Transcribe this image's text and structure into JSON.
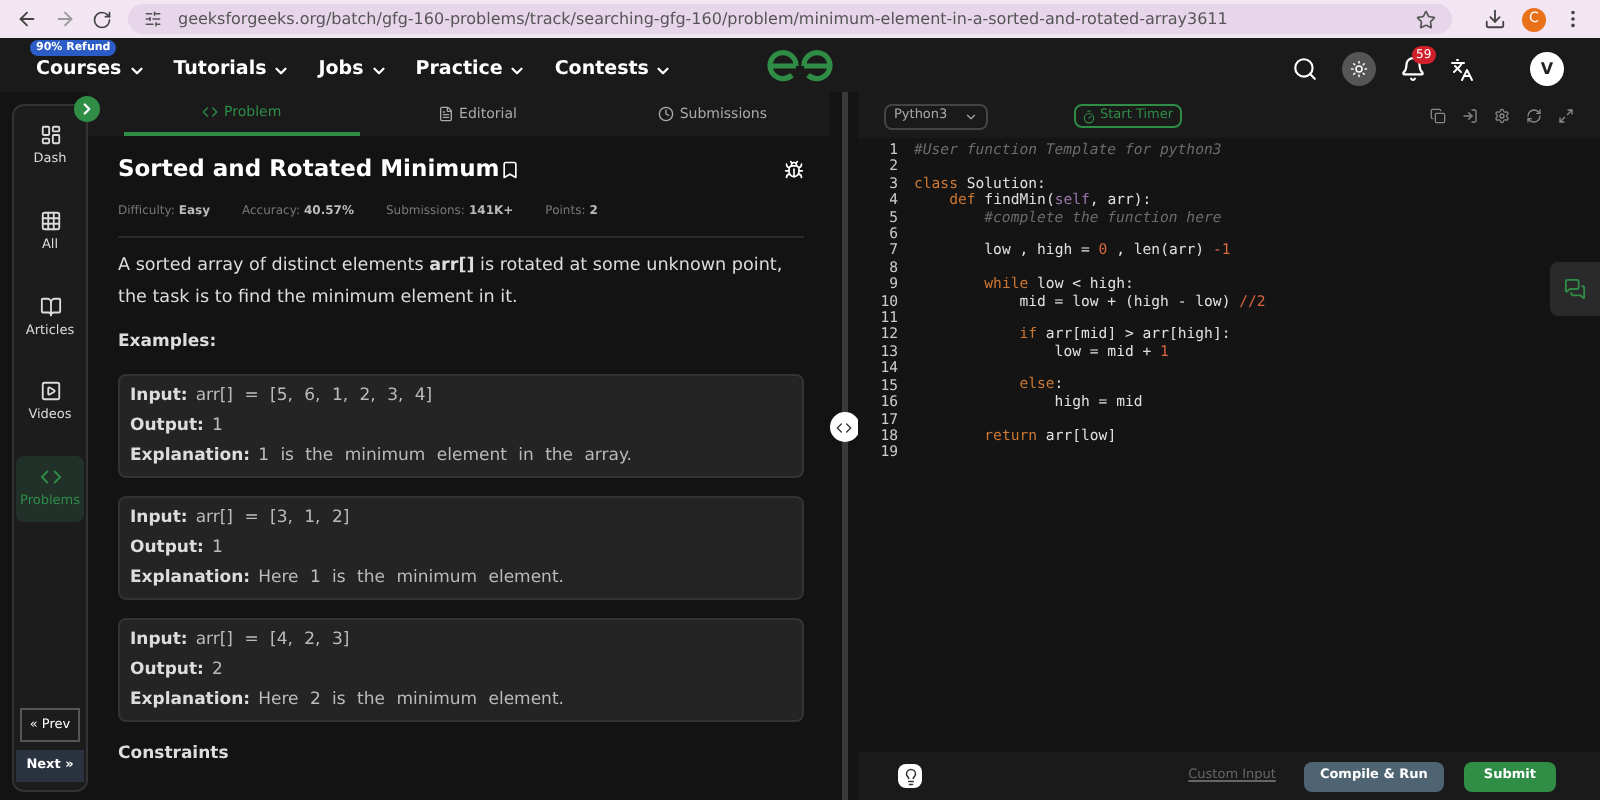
{
  "browser": {
    "url": "geeksforgeeks.org/batch/gfg-160-problems/track/searching-gfg-160/problem/minimum-element-in-a-sorted-and-rotated-array3611",
    "profile": "C"
  },
  "nav": {
    "badge": "90% Refund",
    "items": [
      "Courses",
      "Tutorials",
      "Jobs",
      "Practice",
      "Contests"
    ],
    "notifications": "59",
    "avatar": "V"
  },
  "sidebar": {
    "items": [
      {
        "label": "Dash",
        "selected": false
      },
      {
        "label": "All",
        "selected": false
      },
      {
        "label": "Articles",
        "selected": false
      },
      {
        "label": "Videos",
        "selected": false
      },
      {
        "label": "Problems",
        "selected": true
      }
    ],
    "prev": "« Prev",
    "next": "Next »"
  },
  "tabs": [
    {
      "label": "Problem",
      "selected": true
    },
    {
      "label": "Editorial",
      "selected": false
    },
    {
      "label": "Submissions",
      "selected": false
    }
  ],
  "problem": {
    "title": "Sorted and Rotated Minimum",
    "stats": [
      {
        "label": "Difficulty:",
        "value": "Easy"
      },
      {
        "label": "Accuracy:",
        "value": "40.57%"
      },
      {
        "label": "Submissions:",
        "value": "141K+"
      },
      {
        "label": "Points:",
        "value": "2"
      }
    ],
    "description": "A sorted array of distinct elements **arr[]** is rotated at some unknown point, the task is to find the minimum element in it.",
    "examples_heading": "Examples:",
    "examples": [
      {
        "lines": [
          {
            "label": "Input:",
            "text": "arr[] = [5, 6, 1, 2, 3, 4]"
          },
          {
            "label": "Output:",
            "text": "1"
          },
          {
            "label": "Explanation:",
            "text": "1 is the minimum element in the array."
          }
        ]
      },
      {
        "lines": [
          {
            "label": "Input:",
            "text": "arr[] = [3, 1, 2]"
          },
          {
            "label": "Output:",
            "text": "1"
          },
          {
            "label": "Explanation:",
            "text": "Here 1 is the minimum element."
          }
        ]
      },
      {
        "lines": [
          {
            "label": "Input:",
            "text": "arr[] = [4, 2, 3]"
          },
          {
            "label": "Output:",
            "text": "2"
          },
          {
            "label": "Explanation:",
            "text": "Here 2 is the minimum element."
          }
        ]
      }
    ],
    "constraints_heading": "Constraints"
  },
  "editor": {
    "language": "Python3",
    "timer": "Start Timer",
    "lines": [
      {
        "number": "1",
        "code": "#User function Template for python3",
        "kind": "comment"
      },
      {
        "number": "2"
      },
      {
        "number": "3",
        "code": "class Solution:",
        "kind": "code"
      },
      {
        "number": "4",
        "code": "    def findMin(self, arr):",
        "kind": "code"
      },
      {
        "number": "5",
        "code": "        #complete the function here",
        "kind": "comment"
      },
      {
        "number": "6"
      },
      {
        "number": "7",
        "code": "        low , high = 0 , len(arr) -1",
        "kind": "code"
      },
      {
        "number": "8"
      },
      {
        "number": "9",
        "code": "        while low < high:",
        "kind": "code"
      },
      {
        "number": "10",
        "code": "            mid = low + (high - low) //2",
        "kind": "code"
      },
      {
        "number": "11"
      },
      {
        "number": "12",
        "code": "            if arr[mid] > arr[high]:",
        "kind": "code"
      },
      {
        "number": "13",
        "code": "                low = mid + 1",
        "kind": "code"
      },
      {
        "number": "14"
      },
      {
        "number": "15",
        "code": "            else:",
        "kind": "code"
      },
      {
        "number": "16",
        "code": "                high = mid",
        "kind": "code"
      },
      {
        "number": "17"
      },
      {
        "number": "18",
        "code": "        return arr[low]",
        "kind": "code"
      },
      {
        "number": "19"
      }
    ],
    "custom_input": "Custom Input",
    "compile": "Compile & Run",
    "submit": "Submit"
  }
}
